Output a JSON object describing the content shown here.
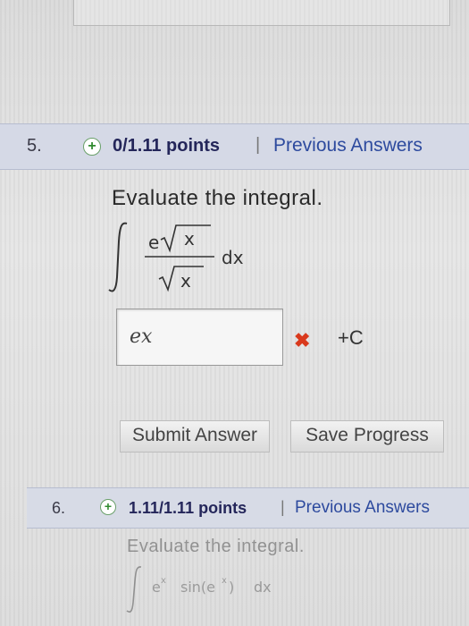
{
  "question5": {
    "number": "5.",
    "points": "0/1.11 points",
    "separator": "|",
    "previous_answers": "Previous Answers",
    "prompt": "Evaluate the integral.",
    "integral": {
      "numerator_base": "e",
      "numerator_radicand": "x",
      "denominator_radicand": "x",
      "differential": "dx"
    },
    "answer_value": "ex",
    "constant": "+C",
    "submit_label": "Submit Answer",
    "save_label": "Save Progress"
  },
  "question6": {
    "number": "6.",
    "points": "1.11/1.11 points",
    "separator": "|",
    "previous_answers": "Previous Answers",
    "prompt": "Evaluate the integral.",
    "integrand": "e",
    "integrand_exp": "x",
    "sin_text": "sin(e",
    "sin_exp": "x",
    "sin_close": ")",
    "differential": "dx"
  },
  "colors": {
    "header_bg": "#d5d9e6",
    "link": "#2d4a9e",
    "points_text": "#24265a",
    "wrong_mark": "#d9391c",
    "correct_plus": "#2f8a2f"
  }
}
